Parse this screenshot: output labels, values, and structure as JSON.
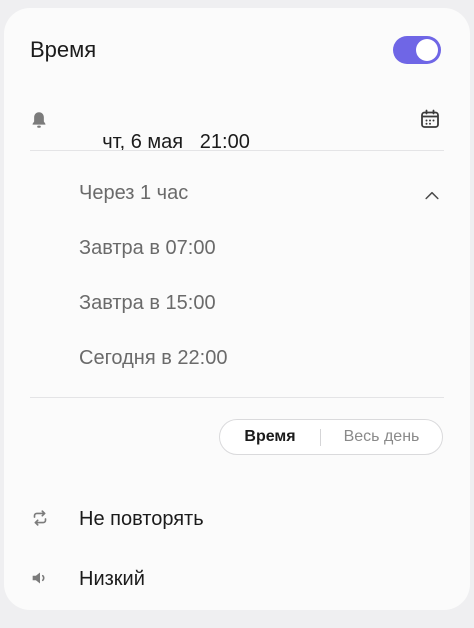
{
  "header": {
    "title": "Время",
    "toggle_on": true
  },
  "reminder": {
    "date": "чт, 6 мая",
    "time": "21:00"
  },
  "quick_options": [
    "Через 1 час",
    "Завтра в 07:00",
    "Завтра в 15:00",
    "Сегодня в 22:00"
  ],
  "mode": {
    "time_label": "Время",
    "all_day_label": "Весь день",
    "selected": "Время"
  },
  "repeat": {
    "label": "Не повторять"
  },
  "priority": {
    "label": "Низкий"
  },
  "colors": {
    "accent": "#6f66e6",
    "background": "#efeff1",
    "card": "#fbfbfb"
  },
  "icons": {
    "bell": "bell-icon",
    "calendar": "calendar-icon",
    "chevron": "chevron-up-icon",
    "repeat": "repeat-icon",
    "volume": "volume-icon"
  }
}
